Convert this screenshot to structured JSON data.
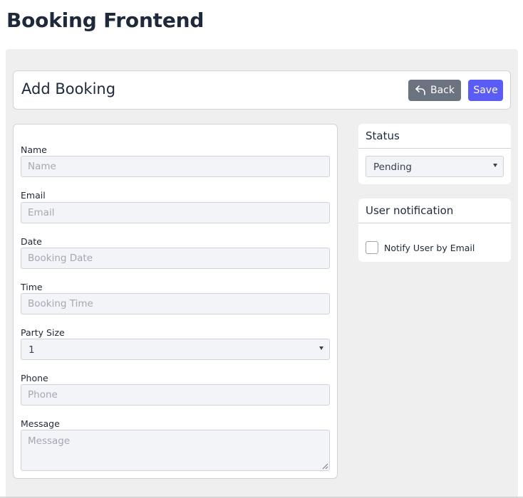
{
  "page": {
    "title": "Booking Frontend"
  },
  "header": {
    "title": "Add Booking",
    "back_label": "Back",
    "save_label": "Save"
  },
  "form": {
    "name": {
      "label": "Name",
      "placeholder": "Name",
      "value": ""
    },
    "email": {
      "label": "Email",
      "placeholder": "Email",
      "value": ""
    },
    "date": {
      "label": "Date",
      "placeholder": "Booking Date",
      "value": ""
    },
    "time": {
      "label": "Time",
      "placeholder": "Booking Time",
      "value": ""
    },
    "party_size": {
      "label": "Party Size",
      "value": "1"
    },
    "phone": {
      "label": "Phone",
      "placeholder": "Phone",
      "value": ""
    },
    "message": {
      "label": "Message",
      "placeholder": "Message",
      "value": ""
    }
  },
  "status": {
    "title": "Status",
    "value": "Pending"
  },
  "notification": {
    "title": "User notification",
    "checkbox_label": "Notify User by Email",
    "checked": false
  },
  "colors": {
    "accent": "#5b5bf6",
    "secondary": "#6b7280",
    "panel_bg": "#efefef"
  }
}
